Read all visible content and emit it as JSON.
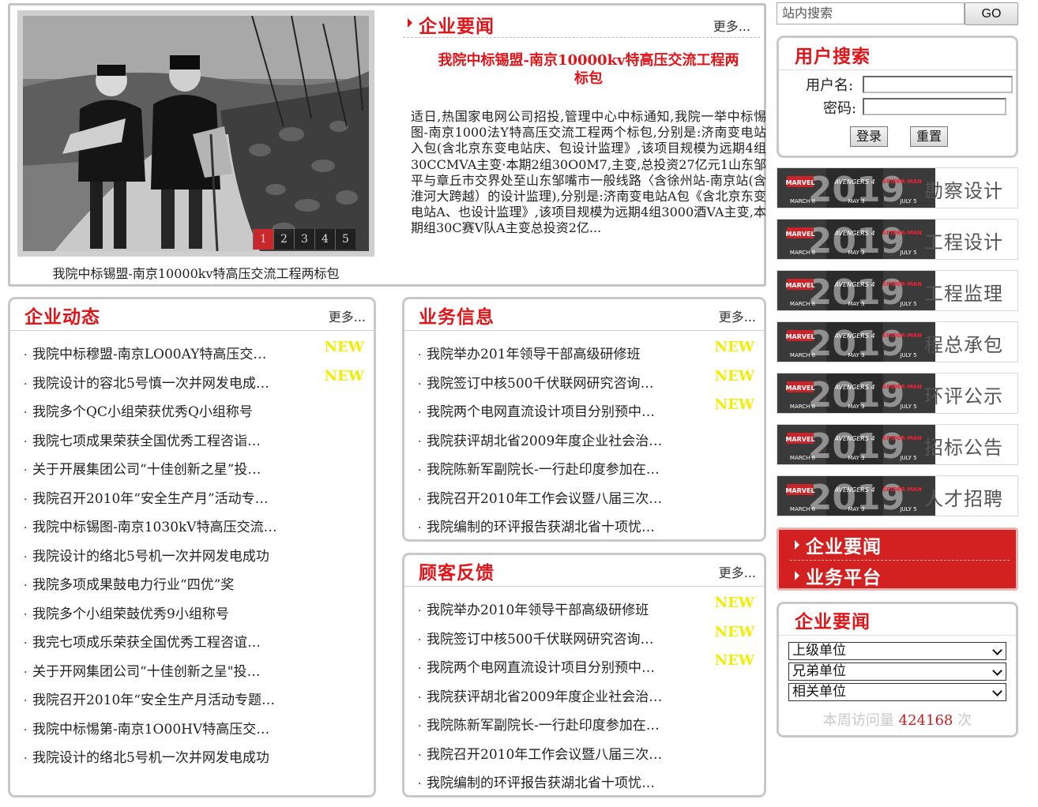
{
  "featured": {
    "photo_caption": "我院中标锡盟-南京10000kv特高压交流工程两标包",
    "pager": [
      "1",
      "2",
      "3",
      "4",
      "5"
    ],
    "active_page": "1",
    "section_title": "企业要闻",
    "more": "更多...",
    "headline": "我院中标锡盟-南京10000kv特高压交流工程两标包",
    "body": "适日,热国家电网公司招投,管理中心中标通知,我院一举中标惕图-南京1000法Y特高压交流工程两个标包,分别是:济南变电站入包(含北京东变电站庆、包设计监理》,该项目规模为远期4组30CCMVA主变·本期2组30O0M7,主变,总投资27亿元1山东邹平与章丘市交界处至山东邹嘴市一般线路〈含徐州站-南京站(含淮河大跨越）的设计监理),分别是:济南变电站A包《含北京东变电站A、也设计监理》,该项目规模为远期4组3000酒VA主变,本期组30C赛V队A主变总投资2亿..."
  },
  "panels": {
    "dongtai": {
      "title": "企业动态",
      "more": "更多...",
      "items": [
        {
          "text": "我院中标穆盟-南京LO00AY特高压交…",
          "new": "NEW"
        },
        {
          "text": "我院设计的容北5号慎一次并网发电成…",
          "new": "NEW"
        },
        {
          "text": "我院多个QC小组荣获优秀Q小组称号",
          "new": ""
        },
        {
          "text": "我院七项成果荣获全国优秀工程咨诣…",
          "new": ""
        },
        {
          "text": "关于开展集团公司“十佳创新之星”投…",
          "new": ""
        },
        {
          "text": "我院召开2010年“安全生产月”活动专…",
          "new": ""
        },
        {
          "text": "我院中标锡图-南京1030kV特高压交流…",
          "new": ""
        },
        {
          "text": "我院设计的络北5号机一次并网发电成功",
          "new": ""
        },
        {
          "text": "我院多项成果鼓电力行业“四优”奖",
          "new": ""
        },
        {
          "text": "我院多个小组荣鼓优秀9小组称号",
          "new": ""
        },
        {
          "text": "我完七项成乐荣获全国优秀工程咨谊…",
          "new": ""
        },
        {
          "text": "关于开网集团公司“十佳创新之呈\"投…",
          "new": ""
        },
        {
          "text": "我院召开2010年“安全生产月活动专题…",
          "new": ""
        },
        {
          "text": "我院中标惕第-南京1O00HV特高压交…",
          "new": ""
        },
        {
          "text": "我院设计的络北5号机一次并网发电成功",
          "new": ""
        }
      ]
    },
    "yewu": {
      "title": "业务信息",
      "more": "更多...",
      "items": [
        {
          "text": "我院举办201年领导干部高级研修班",
          "new": "NEW"
        },
        {
          "text": "我院签订中核500千伏联网研究咨询…",
          "new": "NEW"
        },
        {
          "text": "我院两个电网直流设计项目分别预中…",
          "new": "NEW"
        },
        {
          "text": "我院获评胡北省2009年度企业社会治…",
          "new": ""
        },
        {
          "text": "我院陈新军副院长-一行赴印度参加在…",
          "new": ""
        },
        {
          "text": "我院召开2010年工作会议暨八届三次…",
          "new": ""
        },
        {
          "text": "我院编制的环评报告获湖北省十项忧…",
          "new": ""
        }
      ]
    },
    "guke": {
      "title": "顾客反馈",
      "more": "更多...",
      "items": [
        {
          "text": "我院举办2010年领导干部高级研修班",
          "new": "NEW"
        },
        {
          "text": "我院签订中核500千伏联网研究咨询…",
          "new": "NEW"
        },
        {
          "text": "我院两个电网直流设计项目分别预中…",
          "new": "NEW"
        },
        {
          "text": "我院获评胡北省2009年度企业社会治…",
          "new": ""
        },
        {
          "text": "我院陈新军副院长-一行赴印度参加在…",
          "new": ""
        },
        {
          "text": "我院召开2010年工作会议暨八届三次…",
          "new": ""
        },
        {
          "text": "我院编制的环评报告获湖北省十项忧…",
          "new": ""
        }
      ]
    }
  },
  "search": {
    "placeholder": "站内搜索",
    "go": "GO"
  },
  "login": {
    "title": "用户搜索",
    "username_label": "用户名:",
    "password_label": "密码:",
    "login_button": "登录",
    "reset_button": "重置"
  },
  "banner_art": {
    "year": "2019",
    "marvel": "MARVEL",
    "march": "MARCH 8",
    "avengers": "AVENGERS 4",
    "may": "MAY 3",
    "spiderman": "SPIDER-MAN",
    "july": "JULY 5"
  },
  "banners": [
    {
      "caption": "勘察设计"
    },
    {
      "caption": "工程设计"
    },
    {
      "caption": "工程监理"
    },
    {
      "caption": "程总承包"
    },
    {
      "caption": "环评公示"
    },
    {
      "caption": "招标公告"
    },
    {
      "caption": "人才招聘"
    }
  ],
  "red_menu": {
    "items": [
      "企业要闻",
      "业务平台"
    ]
  },
  "links": {
    "title": "企业要闻",
    "selects": [
      "上级单位",
      "兄弟单位",
      "相关单位"
    ],
    "visits_prefix": "本周访问量",
    "visits_count": "424168",
    "visits_suffix": "次"
  },
  "colors": {
    "accent_red": "#e0151a",
    "new_badge": "#f3ec05",
    "menu_red": "#d32121",
    "border_gray": "#c8c8c8"
  }
}
